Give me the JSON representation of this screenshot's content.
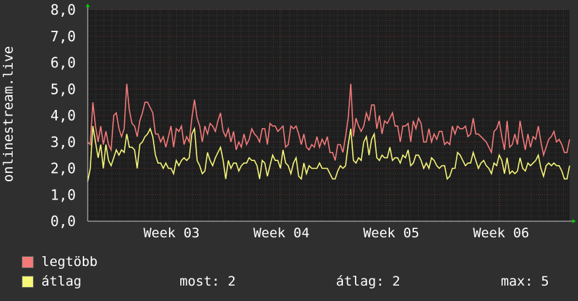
{
  "ylabel": "onlinestream.live",
  "legend": [
    {
      "name": "legtöbb",
      "color": "#f47a7a"
    },
    {
      "name": "átlag",
      "color": "#f7f77a"
    }
  ],
  "stats": {
    "most_label": "most:",
    "most_value": "2",
    "avg_label": "átlag:",
    "avg_value": "2",
    "max_label": "max:",
    "max_value": "5"
  },
  "colors": {
    "background": "#2f2f2f",
    "plot_background": "#1e1e1e",
    "grid_minor": "#3a3a3a",
    "grid_major": "#6a2a2a",
    "axis_arrow": "#00cc00",
    "text": "#ffffff"
  },
  "chart_data": {
    "type": "line",
    "ylim": [
      0,
      8
    ],
    "y_ticks": [
      "0,0",
      "1,0",
      "2,0",
      "3,0",
      "4,0",
      "5,0",
      "6,0",
      "7,0",
      "8,0"
    ],
    "x_ticks": [
      {
        "label": "Week 03",
        "pos": 0.171
      },
      {
        "label": "Week 04",
        "pos": 0.399
      },
      {
        "label": "Week 05",
        "pos": 0.627
      },
      {
        "label": "Week 06",
        "pos": 0.855
      }
    ],
    "series": [
      {
        "name": "legtöbb",
        "values": [
          3.0,
          2.9,
          4.5,
          3.6,
          3.0,
          3.6,
          2.9,
          3.4,
          2.9,
          2.7,
          4.0,
          4.1,
          3.5,
          3.2,
          3.5,
          5.2,
          4.2,
          3.7,
          3.6,
          3.2,
          3.8,
          4.1,
          4.5,
          4.5,
          4.3,
          4.1,
          3.3,
          3.3,
          3.0,
          3.2,
          2.8,
          3.2,
          3.6,
          2.8,
          3.5,
          3.4,
          3.6,
          2.9,
          3.2,
          3.0,
          3.9,
          4.6,
          3.9,
          3.6,
          3.0,
          3.6,
          3.3,
          3.7,
          3.6,
          3.4,
          3.8,
          4.1,
          3.4,
          3.2,
          3.5,
          3.0,
          3.4,
          2.7,
          3.0,
          2.8,
          3.3,
          2.9,
          3.1,
          3.5,
          3.3,
          3.2,
          3.0,
          3.5,
          3.5,
          2.9,
          3.7,
          3.6,
          3.6,
          3.4,
          3.5,
          3.6,
          2.8,
          2.9,
          3.6,
          3.5,
          3.6,
          3.3,
          2.9,
          3.3,
          2.8,
          2.7,
          2.9,
          2.8,
          3.2,
          2.8,
          3.1,
          2.9,
          3.2,
          2.6,
          2.6,
          2.3,
          2.9,
          2.9,
          2.6,
          3.2,
          3.9,
          5.2,
          3.2,
          3.9,
          3.6,
          3.4,
          3.6,
          4.1,
          3.8,
          4.4,
          4.4,
          3.5,
          4.0,
          3.3,
          3.8,
          3.7,
          3.9,
          4.1,
          3.6,
          3.6,
          3.0,
          3.6,
          3.6,
          3.7,
          3.0,
          3.8,
          3.5,
          3.9,
          3.7,
          3.0,
          3.0,
          3.5,
          3.0,
          3.3,
          3.1,
          3.4,
          3.4,
          2.9,
          3.0,
          2.9,
          3.6,
          3.3,
          3.6,
          3.5,
          3.5,
          3.6,
          3.2,
          3.3,
          3.9,
          3.3,
          3.3,
          3.2,
          3.1,
          3.0,
          2.8,
          2.6,
          3.4,
          3.5,
          3.8,
          3.2,
          2.7,
          3.8,
          2.8,
          2.9,
          3.3,
          2.9,
          3.8,
          3.2,
          2.7,
          3.3,
          2.8,
          3.2,
          3.1,
          3.6,
          3.0,
          2.5,
          2.8,
          3.1,
          3.2,
          3.4,
          3.0,
          3.1,
          2.9,
          2.6,
          2.6,
          3.1
        ],
        "color": "#f47a7a"
      },
      {
        "name": "átlag",
        "values": [
          1.5,
          2.0,
          3.6,
          3.0,
          2.4,
          2.9,
          2.0,
          2.9,
          2.3,
          2.1,
          2.4,
          2.7,
          2.5,
          2.7,
          2.6,
          3.3,
          2.8,
          2.8,
          2.7,
          2.0,
          2.9,
          3.0,
          3.2,
          3.3,
          3.5,
          3.2,
          2.5,
          2.2,
          2.2,
          2.0,
          2.2,
          2.0,
          2.0,
          1.8,
          2.3,
          2.1,
          2.3,
          2.4,
          2.3,
          2.4,
          3.3,
          3.5,
          2.3,
          2.1,
          1.8,
          1.9,
          2.6,
          2.3,
          2.1,
          2.4,
          2.6,
          2.8,
          2.3,
          1.6,
          2.3,
          2.0,
          2.2,
          2.2,
          1.9,
          2.1,
          2.2,
          2.2,
          2.4,
          2.3,
          2.3,
          2.1,
          1.6,
          2.3,
          2.2,
          1.7,
          2.1,
          2.5,
          2.3,
          2.3,
          2.0,
          2.7,
          2.2,
          2.1,
          1.8,
          2.2,
          2.4,
          1.7,
          1.6,
          2.2,
          1.8,
          2.1,
          2.0,
          2.0,
          2.0,
          2.2,
          2.0,
          2.0,
          2.0,
          1.8,
          1.6,
          1.6,
          1.9,
          2.1,
          2.0,
          2.1,
          2.9,
          3.5,
          2.3,
          2.2,
          2.4,
          2.3,
          3.0,
          3.2,
          2.5,
          3.1,
          3.3,
          2.4,
          2.3,
          2.5,
          2.4,
          2.4,
          2.8,
          2.3,
          2.4,
          2.4,
          2.2,
          2.5,
          2.4,
          2.7,
          2.1,
          2.2,
          2.5,
          2.5,
          2.3,
          2.0,
          2.2,
          2.0,
          2.4,
          2.3,
          2.1,
          2.0,
          2.1,
          2.1,
          1.6,
          1.7,
          2.0,
          2.0,
          2.6,
          2.5,
          2.3,
          2.1,
          2.2,
          2.2,
          2.6,
          2.3,
          2.0,
          2.2,
          2.3,
          2.1,
          2.0,
          1.8,
          2.2,
          2.1,
          2.5,
          2.3,
          1.8,
          2.4,
          1.8,
          1.9,
          1.8,
          1.9,
          2.4,
          2.0,
          1.9,
          2.2,
          2.1,
          2.2,
          2.3,
          2.5,
          2.0,
          1.7,
          2.1,
          2.2,
          2.1,
          2.2,
          2.1,
          2.1,
          1.9,
          1.6,
          1.6,
          2.1
        ],
        "color": "#f7f77a"
      }
    ]
  }
}
